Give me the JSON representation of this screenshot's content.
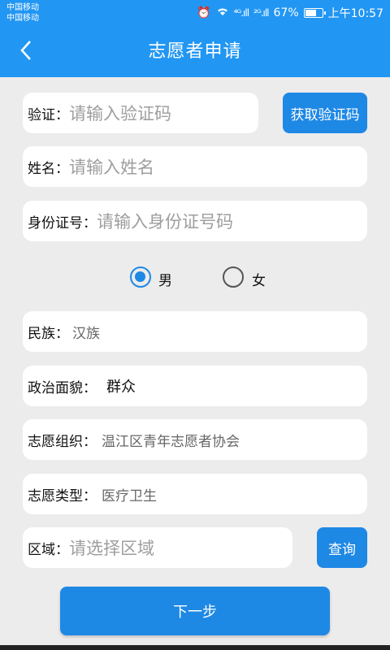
{
  "status_bar": {
    "carrier1": "中国移动",
    "carrier2": "中国移动",
    "signal1": "⁴ᴳ.ıll",
    "signal2": "²ᴳ.ıll",
    "battery": "67%",
    "time": "上午10:57"
  },
  "header": {
    "title": "志愿者申请",
    "back_icon": "‹"
  },
  "form": {
    "verify": {
      "label": "验证：",
      "placeholder": "请输入验证码",
      "button": "获取验证码"
    },
    "name": {
      "label": "姓名：",
      "placeholder": "请输入姓名"
    },
    "id_number": {
      "label": "身份证号：",
      "placeholder": "请输入身份证号码"
    },
    "gender": {
      "male": "男",
      "female": "女",
      "selected": "男"
    },
    "ethnicity": {
      "label": "民族：",
      "value": "汉族"
    },
    "political": {
      "label": "政治面貌：",
      "value": "群众"
    },
    "organization": {
      "label": "志愿组织：",
      "value": "温江区青年志愿者协会"
    },
    "type": {
      "label": "志愿类型：",
      "value": "医疗卫生"
    },
    "region": {
      "label": "区域：",
      "placeholder": "请选择区域",
      "button": "查询"
    }
  },
  "next_button": "下一步",
  "colors": {
    "primary": "#2196f3",
    "button": "#1e88e5",
    "background": "#ececec"
  }
}
